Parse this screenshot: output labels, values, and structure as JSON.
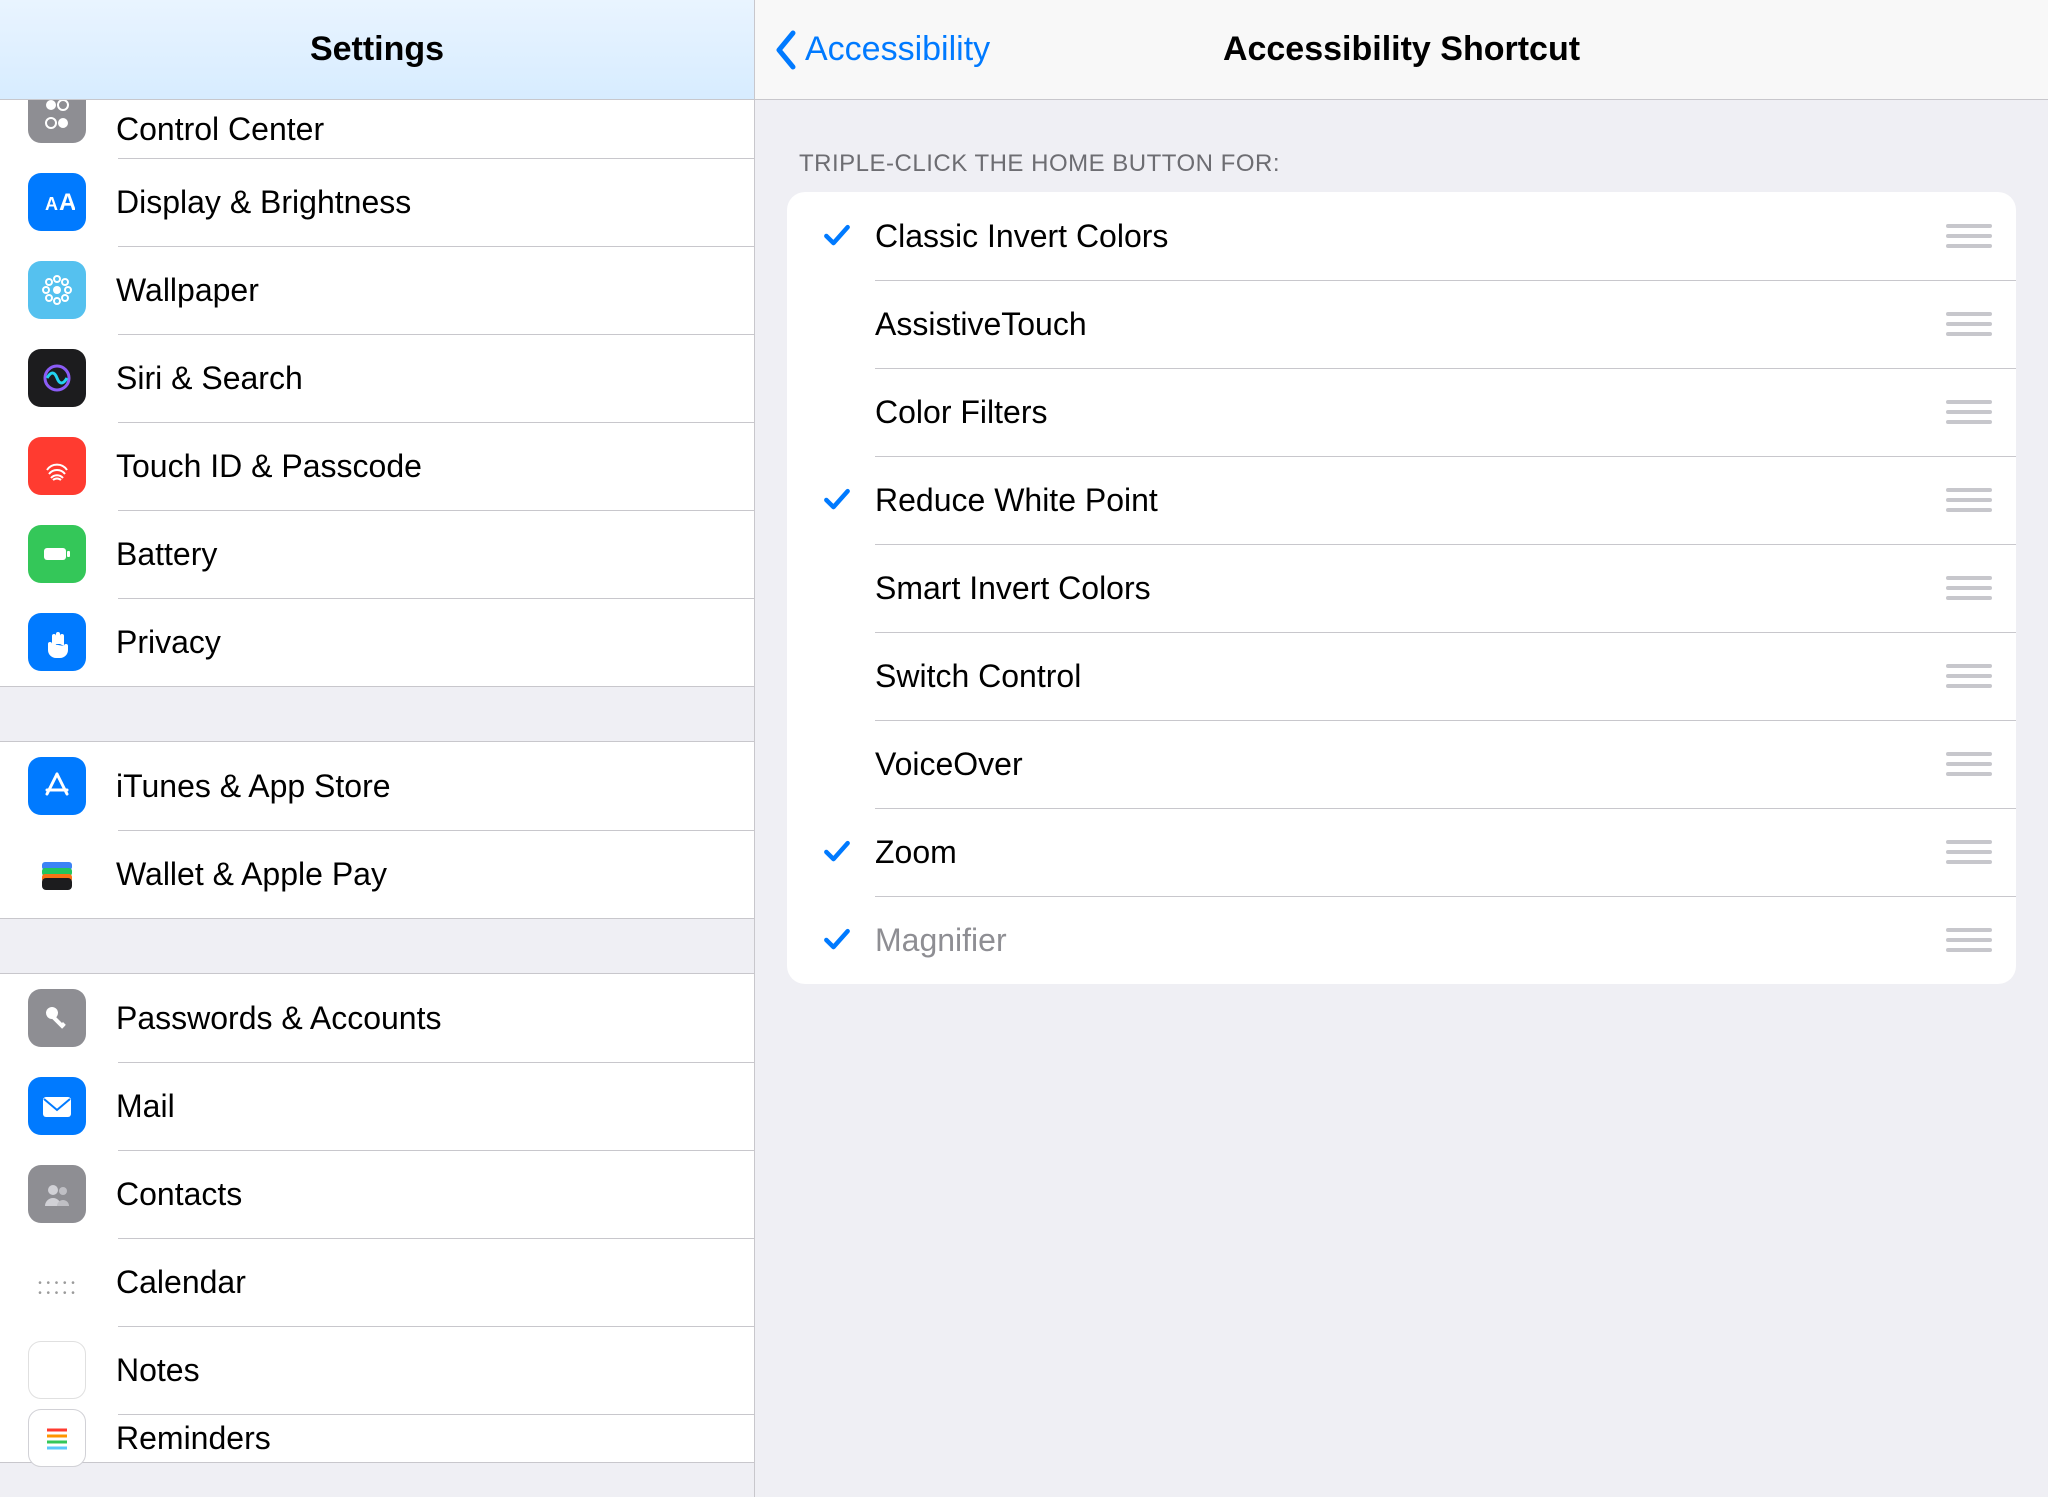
{
  "sidebar": {
    "title": "Settings",
    "groups": [
      {
        "items": [
          {
            "id": "control-center",
            "label": "Control Center",
            "icon": "toggles-icon",
            "bg": "bg-gray"
          },
          {
            "id": "display",
            "label": "Display & Brightness",
            "icon": "text-size-icon",
            "bg": "bg-blue"
          },
          {
            "id": "wallpaper",
            "label": "Wallpaper",
            "icon": "flower-icon",
            "bg": "bg-cyan"
          },
          {
            "id": "siri",
            "label": "Siri & Search",
            "icon": "siri-icon",
            "bg": "bg-black"
          },
          {
            "id": "touchid",
            "label": "Touch ID & Passcode",
            "icon": "fingerprint-icon",
            "bg": "bg-red"
          },
          {
            "id": "battery",
            "label": "Battery",
            "icon": "battery-icon",
            "bg": "bg-green"
          },
          {
            "id": "privacy",
            "label": "Privacy",
            "icon": "hand-icon",
            "bg": "bg-blue"
          }
        ]
      },
      {
        "items": [
          {
            "id": "itunes",
            "label": "iTunes & App Store",
            "icon": "appstore-icon",
            "bg": "bg-blue"
          },
          {
            "id": "wallet",
            "label": "Wallet & Apple Pay",
            "icon": "wallet-icon",
            "bg": "bg-none"
          }
        ]
      },
      {
        "items": [
          {
            "id": "passwords",
            "label": "Passwords & Accounts",
            "icon": "key-icon",
            "bg": "bg-gray"
          },
          {
            "id": "mail",
            "label": "Mail",
            "icon": "mail-icon",
            "bg": "bg-blue"
          },
          {
            "id": "contacts",
            "label": "Contacts",
            "icon": "contacts-icon",
            "bg": "bg-gray"
          },
          {
            "id": "calendar",
            "label": "Calendar",
            "icon": "calendar-icon",
            "bg": "bg-none"
          },
          {
            "id": "notes",
            "label": "Notes",
            "icon": "notes-icon",
            "bg": "bg-none"
          },
          {
            "id": "reminders",
            "label": "Reminders",
            "icon": "reminders-icon",
            "bg": "bg-white"
          }
        ]
      }
    ]
  },
  "detail": {
    "back_label": "Accessibility",
    "title": "Accessibility Shortcut",
    "section_header": "TRIPLE-CLICK THE HOME BUTTON FOR:",
    "options": [
      {
        "label": "Classic Invert Colors",
        "checked": true,
        "disabled": false
      },
      {
        "label": "AssistiveTouch",
        "checked": false,
        "disabled": false
      },
      {
        "label": "Color Filters",
        "checked": false,
        "disabled": false
      },
      {
        "label": "Reduce White Point",
        "checked": true,
        "disabled": false
      },
      {
        "label": "Smart Invert Colors",
        "checked": false,
        "disabled": false
      },
      {
        "label": "Switch Control",
        "checked": false,
        "disabled": false
      },
      {
        "label": "VoiceOver",
        "checked": false,
        "disabled": false
      },
      {
        "label": "Zoom",
        "checked": true,
        "disabled": false
      },
      {
        "label": "Magnifier",
        "checked": true,
        "disabled": true
      }
    ]
  }
}
